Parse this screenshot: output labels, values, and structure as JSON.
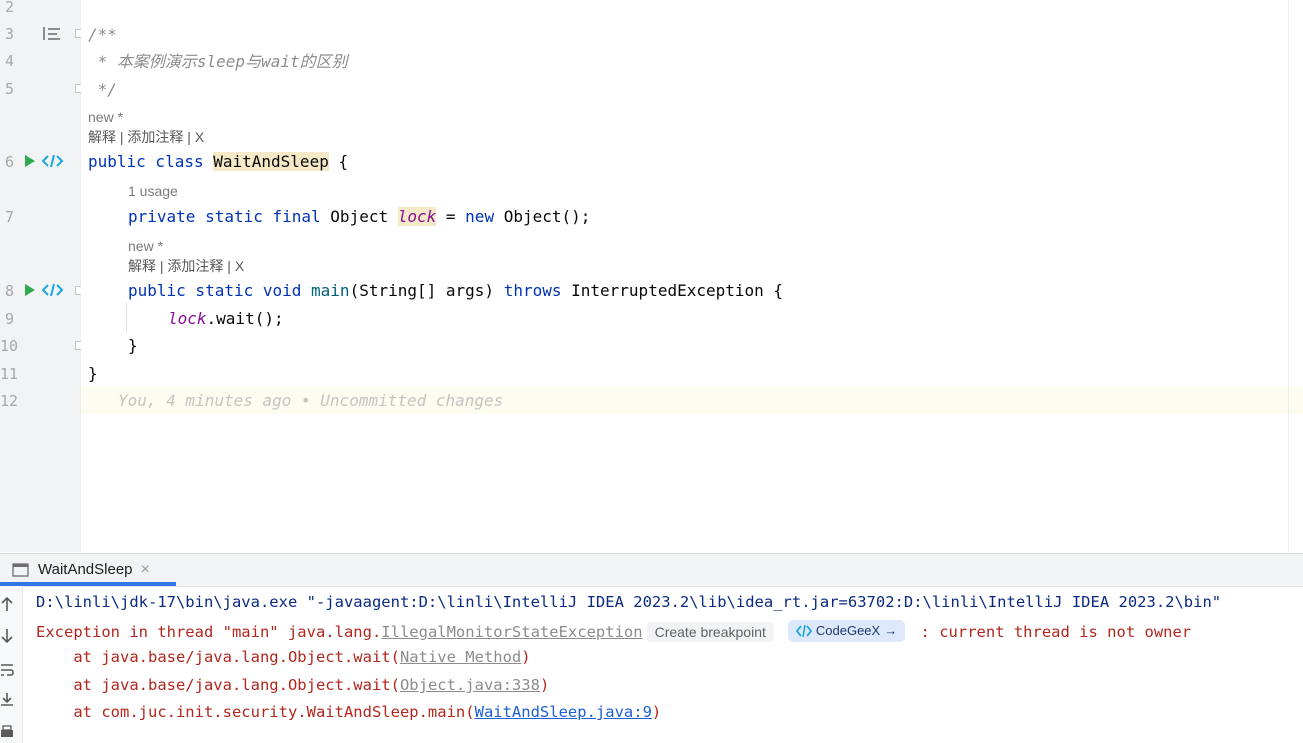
{
  "editor": {
    "line_numbers": [
      "2",
      "3",
      "4",
      "5",
      "6",
      "7",
      "8",
      "9",
      "10",
      "11",
      "12"
    ],
    "line3": "/**",
    "line4": " * 本案例演示sleep与wait的区别",
    "line5": " */",
    "hint_new_1": "new *",
    "hint_actions_1": "解释 | 添加注释 | X",
    "line6_kw": "public class ",
    "line6_name": "WaitAndSleep",
    "line6_rest": " {",
    "usage_hint": "1 usage",
    "line7_kw": "private static final ",
    "line7_type": "Object ",
    "line7_field": "lock",
    "line7_eq": " = ",
    "line7_new": "new ",
    "line7_rest": "Object();",
    "hint_new_2": "new *",
    "hint_actions_2": "解释 | 添加注释 | X",
    "line8_kw": "public static void ",
    "line8_name": "main",
    "line8_params": "(String[] args) ",
    "line8_throws": "throws ",
    "line8_rest": "InterruptedException {",
    "line9_field": "lock",
    "line9_rest": ".wait();",
    "line10": "}",
    "line11": "}",
    "line12_blame": "You, 4 minutes ago • Uncommitted changes"
  },
  "run_panel": {
    "tab_label": "WaitAndSleep",
    "tab_close": "×",
    "console": {
      "line1": "D:\\linli\\jdk-17\\bin\\java.exe \"-javaagent:D:\\linli\\IntelliJ IDEA 2023.2\\lib\\idea_rt.jar=63702:D:\\linli\\IntelliJ IDEA 2023.2\\bin\"",
      "line2_prefix": "Exception in thread \"main\" java.lang.",
      "line2_exception": "IllegalMonitorStateException",
      "create_breakpoint": "Create breakpoint",
      "codegeex_label": "CodeGeeX",
      "codegeex_arrow": "→",
      "line2_suffix": " : current thread is not owner",
      "line3_prefix": "    at java.base/java.lang.Object.wait(",
      "line3_link": "Native Method",
      "line3_suffix": ")",
      "line4_prefix": "    at java.base/java.lang.Object.wait(",
      "line4_link": "Object.java:338",
      "line4_suffix": ")",
      "line5_prefix": "    at com.juc.init.security.WaitAndSleep.main(",
      "line5_link": "WaitAndSleep.java:9",
      "line5_suffix": ")"
    }
  },
  "colors": {
    "keyword": "#0033b3",
    "comment": "#8c8c8c",
    "static_field": "#871094",
    "error_red": "#b3261e",
    "link_blue": "#1a5fd6",
    "run_green": "#2eaa50"
  }
}
